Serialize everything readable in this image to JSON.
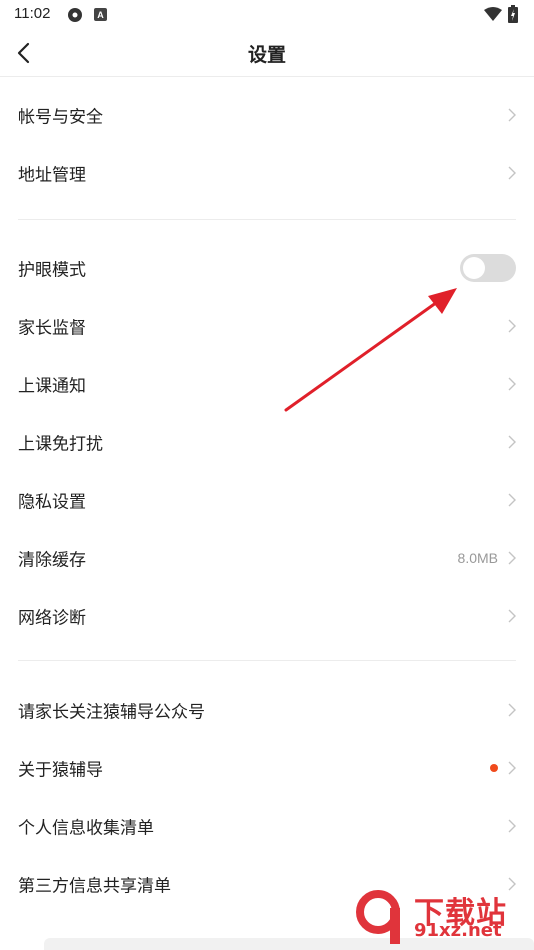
{
  "status_bar": {
    "time": "11:02"
  },
  "header": {
    "title": "设置"
  },
  "sections": [
    {
      "items": [
        {
          "label": "帐号与安全"
        },
        {
          "label": "地址管理"
        }
      ]
    },
    {
      "items": [
        {
          "label": "护眼模式",
          "toggle_on": false
        },
        {
          "label": "家长监督"
        },
        {
          "label": "上课通知"
        },
        {
          "label": "上课免打扰"
        },
        {
          "label": "隐私设置"
        },
        {
          "label": "清除缓存",
          "value": "8.0MB"
        },
        {
          "label": "网络诊断"
        }
      ]
    },
    {
      "items": [
        {
          "label": "请家长关注猿辅导公众号"
        },
        {
          "label": "关于猿辅导",
          "badge": "red-dot"
        },
        {
          "label": "个人信息收集清单"
        },
        {
          "label": "第三方信息共享清单"
        }
      ]
    }
  ],
  "colors": {
    "annotation_arrow": "#e0202a",
    "badge_dot": "#f04a1c",
    "toggle_off": "#dcdcdc"
  },
  "watermark": {
    "top": "下载站",
    "bottom": "91xz.net"
  }
}
